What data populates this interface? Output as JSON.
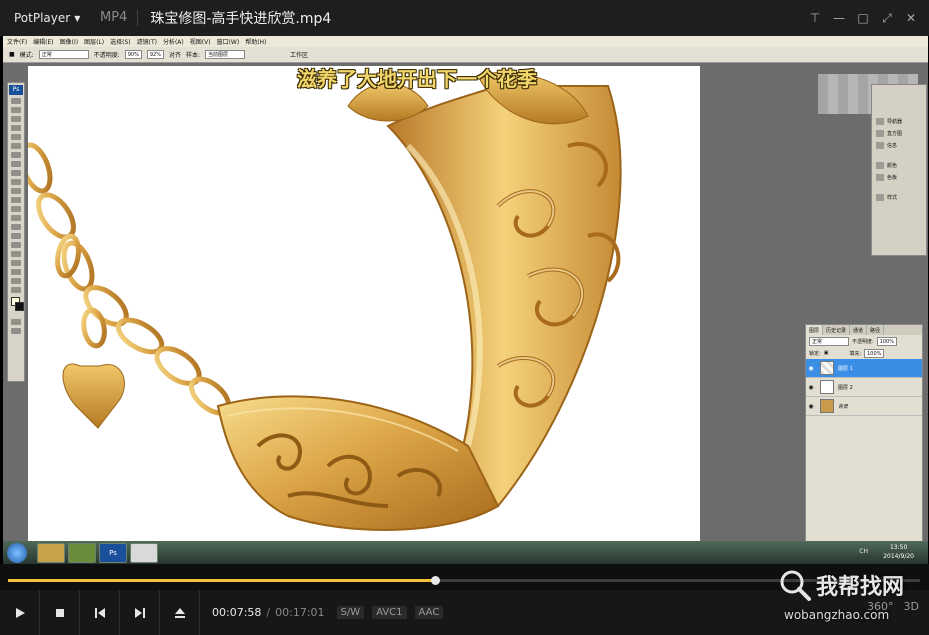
{
  "player": {
    "app_name": "PotPlayer",
    "format_label": "MP4",
    "file_title": "珠宝修图-高手快进欣赏.mp4"
  },
  "video": {
    "subtitle": "滋养了大地开出下一个花季",
    "ps_menus": [
      "文件(F)",
      "编辑(E)",
      "图像(I)",
      "图层(L)",
      "选择(S)",
      "滤镜(T)",
      "分析(A)",
      "视图(V)",
      "窗口(W)",
      "帮助(H)"
    ],
    "ps_options": {
      "mode_label": "模式:",
      "mode_value": "正常",
      "opacity_label": "不透明度:",
      "opacity_value": "90%",
      "flow_value": "92%",
      "align_label": "对齐",
      "sample_label": "样本:",
      "sample_value": "当前图层",
      "workspace_label": "工作区"
    },
    "ps_panels_small": [
      "导航器",
      "直方图",
      "信息",
      "颜色",
      "色板",
      "样式"
    ],
    "layers_panel": {
      "tabs": [
        "图层",
        "历史记录",
        "通道",
        "路径"
      ],
      "blend_mode": "正常",
      "opacity_label": "不透明度:",
      "opacity_value": "100%",
      "lock_label": "锁定:",
      "fill_label": "填充:",
      "fill_value": "100%",
      "layers": [
        {
          "name": "图层 1",
          "selected": true
        },
        {
          "name": "图层 2",
          "selected": false
        },
        {
          "name": "背景",
          "selected": false
        }
      ]
    },
    "taskbar": {
      "apps": [
        "",
        "",
        "",
        "Ps",
        ""
      ],
      "clock_time": "13:50",
      "clock_date": "2014/9/20",
      "tray_text": "CH"
    }
  },
  "playback": {
    "current_time": "00:07:58",
    "separator": "/",
    "total_time": "00:17:01",
    "progress_fraction": 0.468,
    "codecs": [
      "S/W",
      "AVC1",
      "AAC"
    ],
    "right_labels": [
      "360°",
      "3D"
    ]
  },
  "watermark": {
    "title": "我帮找网",
    "url": "wobangzhao.com"
  },
  "colors": {
    "seek_fill": "#f2c23b",
    "subtitle": "#f1d66c",
    "selected_layer": "#3a8ee6",
    "gold_light": "#f4d27a",
    "gold_dark": "#b57a23"
  }
}
